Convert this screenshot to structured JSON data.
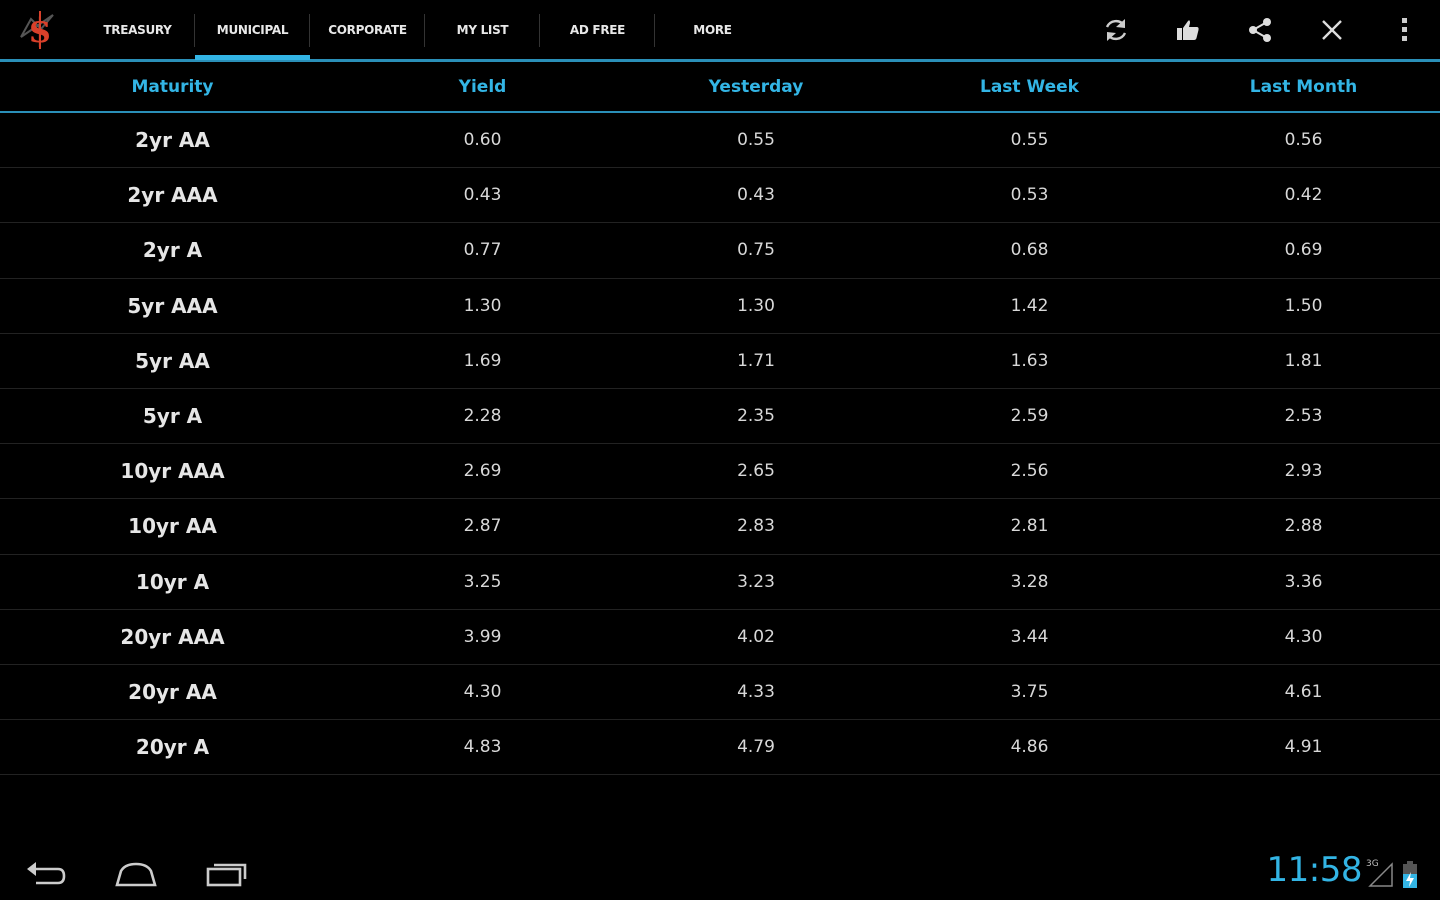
{
  "actionbar": {
    "app_icon": "dollar-logo-icon",
    "tabs": [
      {
        "label": "TREASURY",
        "selected": false
      },
      {
        "label": "MUNICIPAL",
        "selected": true
      },
      {
        "label": "CORPORATE",
        "selected": false
      },
      {
        "label": "MY LIST",
        "selected": false
      },
      {
        "label": "AD FREE",
        "selected": false
      },
      {
        "label": "MORE",
        "selected": false
      }
    ],
    "actions": [
      "refresh-icon",
      "thumbs-up-icon",
      "share-icon",
      "close-icon",
      "overflow-menu-icon"
    ]
  },
  "table": {
    "headers": [
      "Maturity",
      "Yield",
      "Yesterday",
      "Last Week",
      "Last Month"
    ],
    "rows": [
      [
        "2yr AA",
        "0.60",
        "0.55",
        "0.55",
        "0.56"
      ],
      [
        "2yr AAA",
        "0.43",
        "0.43",
        "0.53",
        "0.42"
      ],
      [
        "2yr A",
        "0.77",
        "0.75",
        "0.68",
        "0.69"
      ],
      [
        "5yr AAA",
        "1.30",
        "1.30",
        "1.42",
        "1.50"
      ],
      [
        "5yr AA",
        "1.69",
        "1.71",
        "1.63",
        "1.81"
      ],
      [
        "5yr A",
        "2.28",
        "2.35",
        "2.59",
        "2.53"
      ],
      [
        "10yr AAA",
        "2.69",
        "2.65",
        "2.56",
        "2.93"
      ],
      [
        "10yr AA",
        "2.87",
        "2.83",
        "2.81",
        "2.88"
      ],
      [
        "10yr A",
        "3.25",
        "3.23",
        "3.28",
        "3.36"
      ],
      [
        "20yr AAA",
        "3.99",
        "4.02",
        "3.44",
        "4.30"
      ],
      [
        "20yr AA",
        "4.30",
        "4.33",
        "3.75",
        "4.61"
      ],
      [
        "20yr A",
        "4.83",
        "4.79",
        "4.86",
        "4.91"
      ]
    ]
  },
  "system_bar": {
    "clock": "11:58",
    "signal_label": "3G",
    "nav": [
      "back-icon",
      "home-icon",
      "recent-apps-icon"
    ]
  },
  "colors": {
    "accent": "#33b5e5",
    "background": "#000000",
    "divider": "#2a8fb8"
  }
}
